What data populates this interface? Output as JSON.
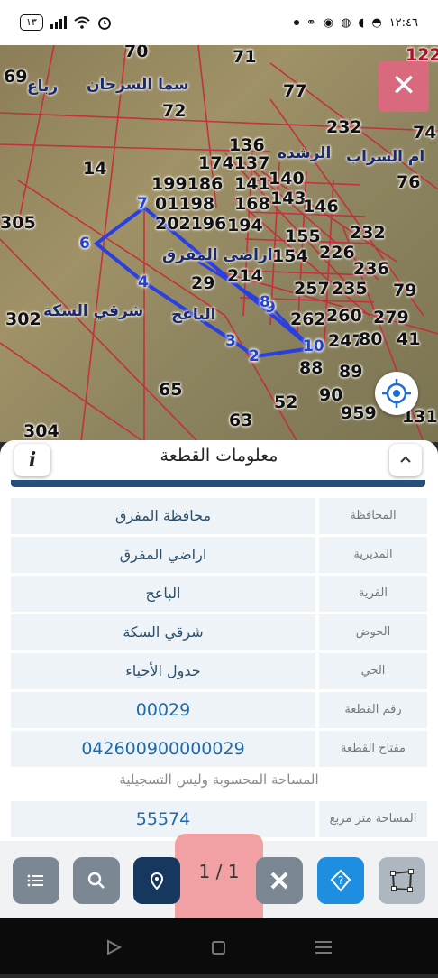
{
  "status_bar": {
    "time": "١٢:٤٦",
    "battery": "١٣"
  },
  "map": {
    "parcel_labels": [
      "70",
      "71",
      "122",
      "69",
      "77",
      "72",
      "232",
      "74",
      "136",
      "174137",
      "14",
      "199186",
      "141",
      "140",
      "76",
      "305",
      "01198",
      "168",
      "143",
      "146",
      "202196",
      "194",
      "232",
      "155",
      "226",
      "154",
      "236",
      "214",
      "29",
      "79",
      "257",
      "235",
      "302",
      "262",
      "260",
      "279",
      "247",
      "80",
      "41",
      "88",
      "89",
      "65",
      "90",
      "52",
      "63",
      "959",
      "131",
      "304"
    ],
    "place_names": [
      "سما السرحان",
      "رباع",
      "ام السراب",
      "الرشده",
      "اراضي المفرق",
      "شرقي السكة",
      "الباعج"
    ],
    "vertices": [
      "7",
      "6",
      "4",
      "3",
      "2",
      "10",
      "9",
      "8"
    ],
    "boundary_color": "#2a3fe0",
    "close_icon": "close-icon",
    "locate_icon": "crosshair-icon"
  },
  "sheet": {
    "title": "معلومات القطعة",
    "info_icon": "info-icon",
    "collapse_icon": "chevron-up-icon",
    "rows": [
      {
        "label": "المحافظة",
        "value": "محافظة المفرق"
      },
      {
        "label": "المديرية",
        "value": "اراضي المفرق"
      },
      {
        "label": "القرية",
        "value": "الباعج"
      },
      {
        "label": "الحوض",
        "value": "شرقي السكة"
      },
      {
        "label": "الحي",
        "value": "جدول الأحياء"
      },
      {
        "label": "رقم القطعة",
        "value": "00029"
      },
      {
        "label": "مفتاح القطعة",
        "value": "042600900000029"
      }
    ],
    "area_note": "المساحة المحسوبة وليس التسجيلية",
    "area_row": {
      "label": "المساحة متر مربع",
      "value": "55574"
    }
  },
  "toolbar": {
    "buttons": [
      "list-icon",
      "search-icon",
      "location-pin-icon",
      "pager",
      "measure-icon",
      "help-icon",
      "polygon-icon"
    ],
    "pager_text": "1 / 1"
  }
}
